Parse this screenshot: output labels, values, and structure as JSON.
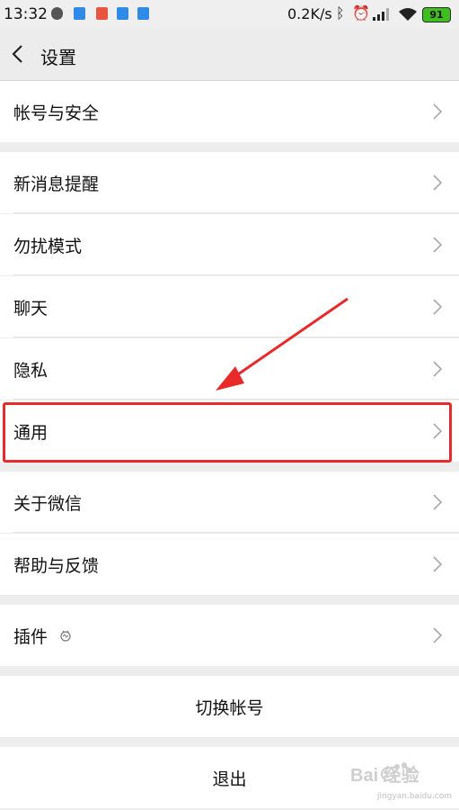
{
  "status_bar": {
    "time": "13:32",
    "network_speed": "0.2K/s",
    "battery": "91",
    "icons": [
      "shield-icon",
      "doc-icon",
      "app-icon",
      "doc-icon",
      "doc-icon",
      "bluetooth-icon",
      "alarm-icon",
      "signal-icon",
      "wifi-icon",
      "battery-icon"
    ]
  },
  "header": {
    "title": "设置"
  },
  "sections": [
    {
      "items": [
        {
          "label": "帐号与安全"
        }
      ]
    },
    {
      "items": [
        {
          "label": "新消息提醒"
        },
        {
          "label": "勿扰模式"
        },
        {
          "label": "聊天"
        },
        {
          "label": "隐私"
        },
        {
          "label": "通用"
        }
      ]
    },
    {
      "items": [
        {
          "label": "关于微信"
        },
        {
          "label": "帮助与反馈"
        }
      ]
    },
    {
      "items": [
        {
          "label": "插件"
        }
      ]
    }
  ],
  "actions": {
    "switch_account": "切换帐号",
    "logout": "退出"
  },
  "watermark": {
    "text": "Bai 经验",
    "url": "jingyan.baidu.com"
  },
  "colors": {
    "highlight": "#e82a2a",
    "battery": "#3fbf1f"
  }
}
